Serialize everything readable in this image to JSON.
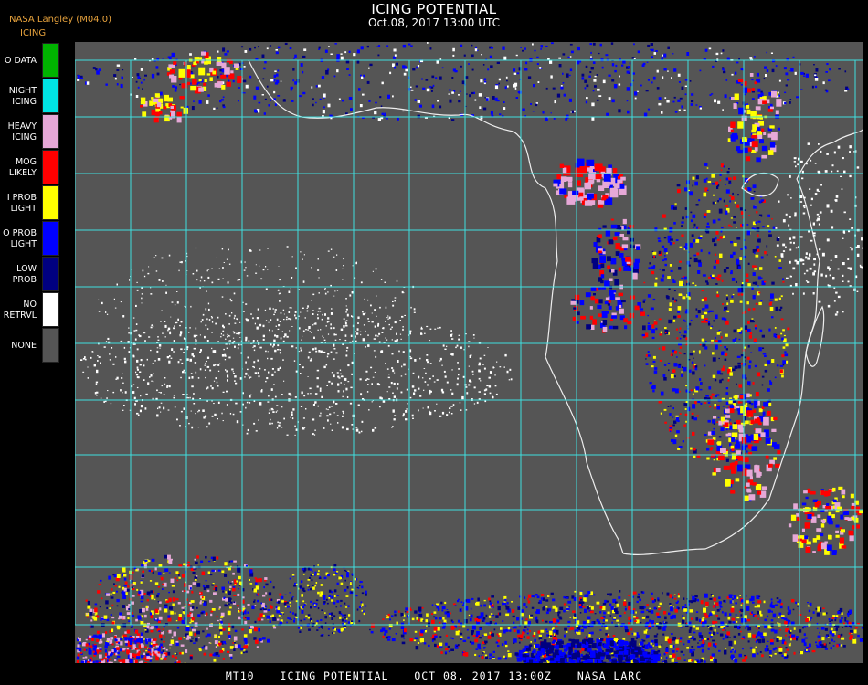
{
  "header": {
    "title": "ICING POTENTIAL",
    "subtitle": "Oct.08, 2017 13:00 UTC",
    "source": "NASA Langley (M04.0)"
  },
  "legend": {
    "title": "ICING",
    "items": [
      {
        "label": "O DATA",
        "color": "#00b300"
      },
      {
        "label": "NIGHT\nICING",
        "color": "#00e5e5"
      },
      {
        "label": "HEAVY\nICING",
        "color": "#e6a8d7"
      },
      {
        "label": "MOG\nLIKELY",
        "color": "#ff0000"
      },
      {
        "label": "I PROB\nLIGHT",
        "color": "#ffff00"
      },
      {
        "label": "O PROB\nLIGHT",
        "color": "#0000ff"
      },
      {
        "label": "LOW\nPROB",
        "color": "#000080"
      },
      {
        "label": "NO\nRETRVL",
        "color": "#ffffff"
      },
      {
        "label": "NONE",
        "color": "#555555"
      }
    ]
  },
  "map": {
    "background_color": "#555555",
    "grid_color": "#40e0e0",
    "grid_label_color": "#cc3333",
    "coastline_color": "#ffffff"
  },
  "footer": {
    "product": "MT10",
    "name": "ICING POTENTIAL",
    "time": "OCT 08, 2017 13:00Z",
    "credit": "NASA LARC"
  }
}
